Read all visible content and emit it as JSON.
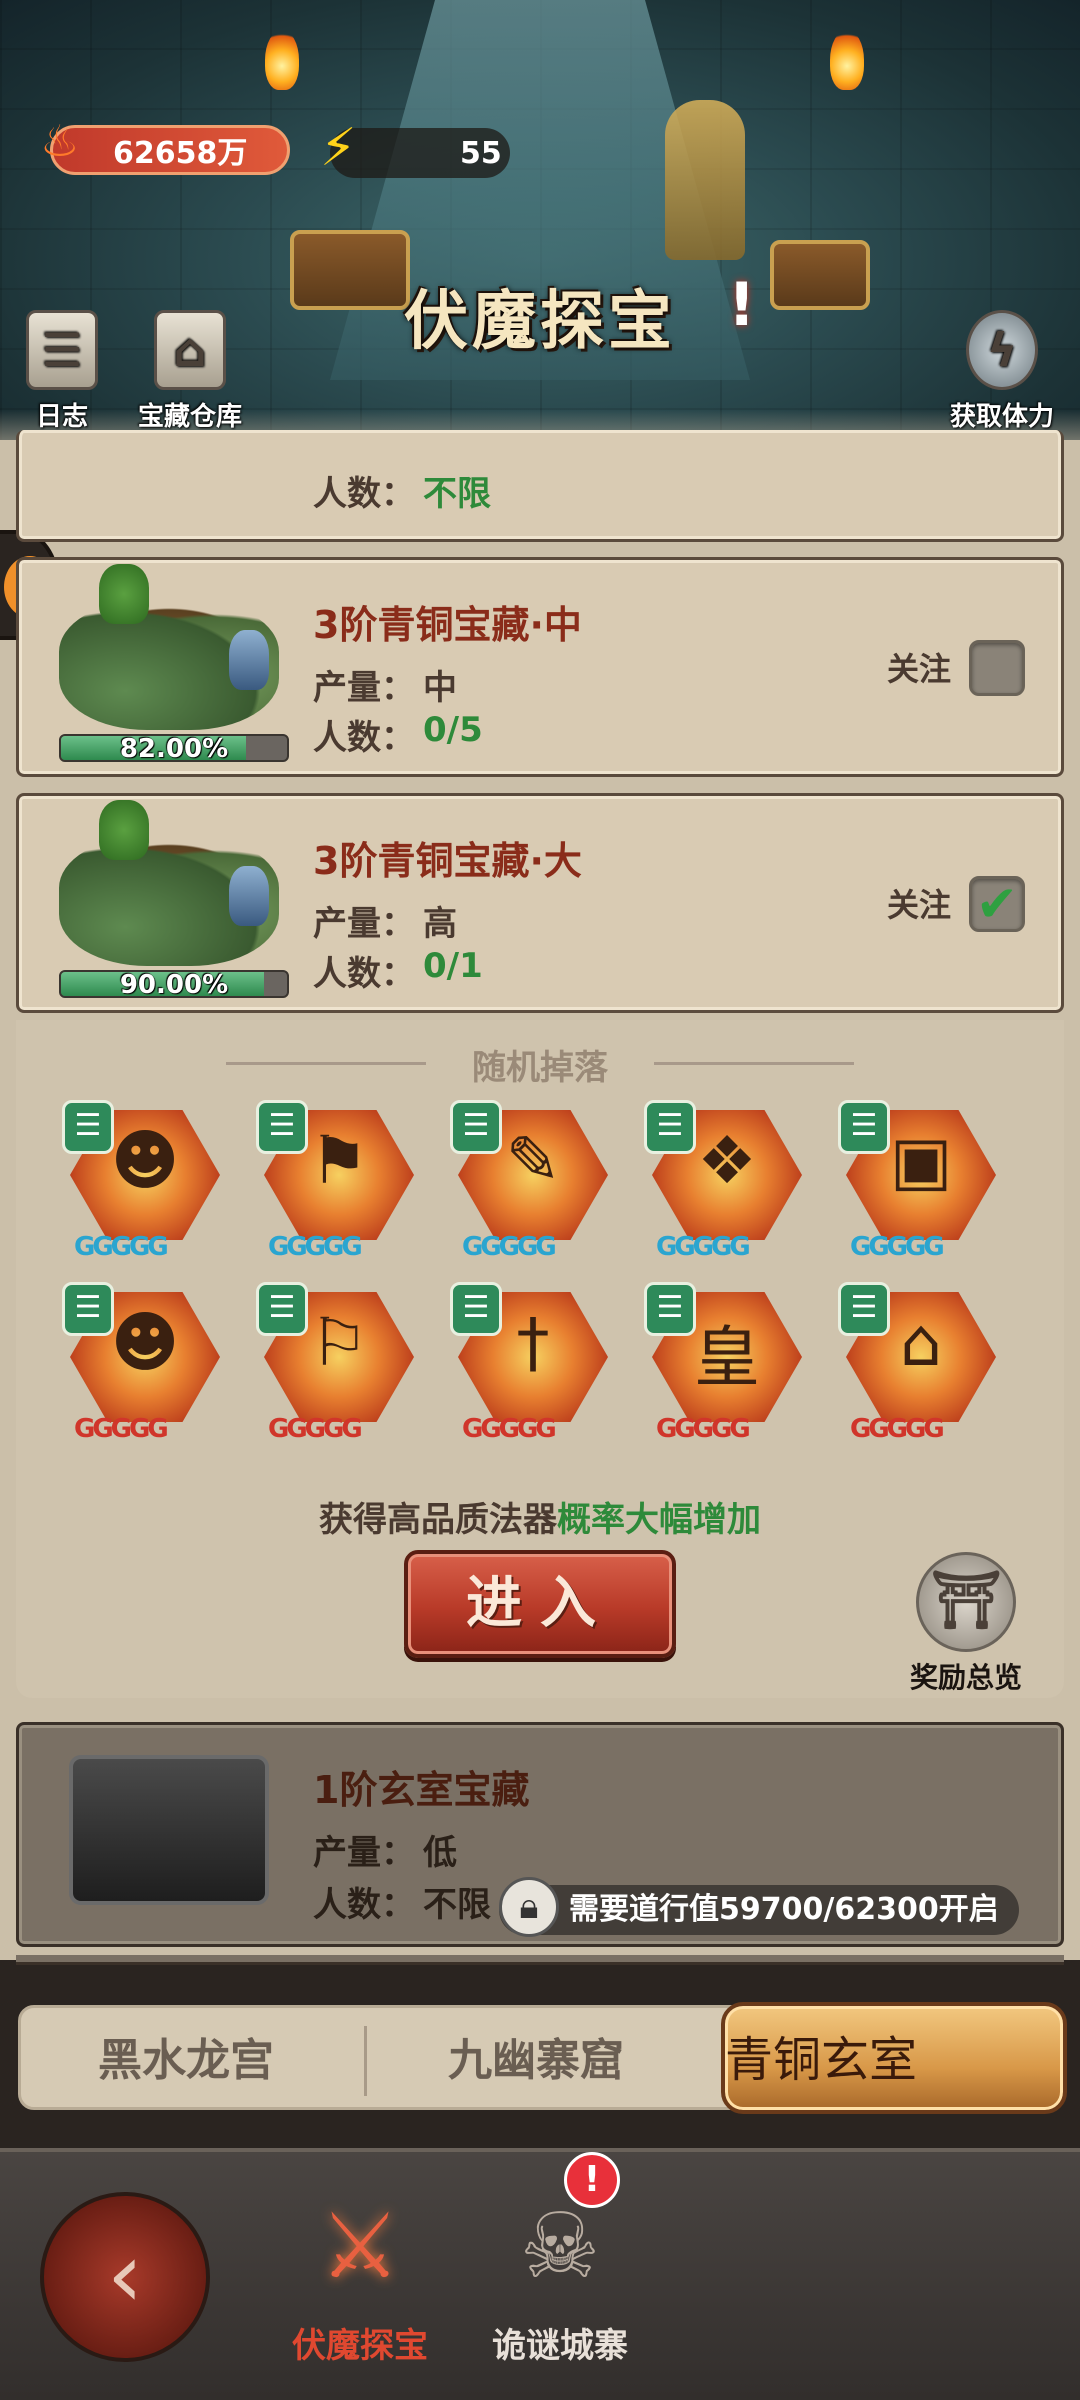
{
  "header": {
    "coins": "62658万",
    "energy": "55",
    "title": "伏魔探宝",
    "title_badge": "!",
    "btn_log": "日志",
    "btn_warehouse": "宝藏仓库",
    "btn_stamina": "获取体力"
  },
  "labels": {
    "output": "产量：",
    "people": "人数：",
    "follow": "关注"
  },
  "cards": [
    {
      "people": "不限"
    },
    {
      "title": "3阶青铜宝藏·中",
      "output": "中",
      "people": "0/5",
      "progress": "82.00%",
      "progress_value": 82.0,
      "followed": false
    },
    {
      "title": "3阶青铜宝藏·大",
      "output": "高",
      "people": "0/1",
      "progress": "90.00%",
      "progress_value": 90.0,
      "followed": true
    }
  ],
  "drops": {
    "title": "随机掉落",
    "items": [
      {
        "icon": "mask-icon",
        "glyph": "☻",
        "stars": "GGGGG",
        "tier": "blue"
      },
      {
        "icon": "banner-icon",
        "glyph": "⚑",
        "stars": "GGGGG",
        "tier": "blue"
      },
      {
        "icon": "brush-icon",
        "glyph": "✎",
        "stars": "GGGGG",
        "tier": "blue"
      },
      {
        "icon": "talisman-icon",
        "glyph": "❖",
        "stars": "GGGGG",
        "tier": "blue"
      },
      {
        "icon": "token-icon",
        "glyph": "▣",
        "stars": "GGGGG",
        "tier": "blue"
      },
      {
        "icon": "opera-mask-icon",
        "glyph": "☻",
        "stars": "GGGGG",
        "tier": "red"
      },
      {
        "icon": "flag-icon",
        "glyph": "⚐",
        "stars": "GGGGG",
        "tier": "red"
      },
      {
        "icon": "dagger-icon",
        "glyph": "†",
        "stars": "GGGGG",
        "tier": "red"
      },
      {
        "icon": "scroll-icon",
        "glyph": "皇",
        "stars": "GGGGG",
        "tier": "red"
      },
      {
        "icon": "pagoda-icon",
        "glyph": "⌂",
        "stars": "GGGGG",
        "tier": "red"
      }
    ],
    "bonus_prefix": "获得高品质法器",
    "bonus_highlight": "概率大幅增加",
    "enter": "进入",
    "reward_overview": "奖励总览"
  },
  "locked_card": {
    "title": "1阶玄室宝藏",
    "output": "低",
    "people": "不限",
    "requirement": "需要道行值59700/62300开启"
  },
  "tabs": [
    "黑水龙宫",
    "九幽寨窟",
    "青铜玄室"
  ],
  "active_tab": 2,
  "nav": {
    "item1": "伏魔探宝",
    "item2": "诡谜城寨",
    "badge": "!"
  },
  "colors": {
    "card_title": "#8a2c1a",
    "highlight_green": "#2e8a3a",
    "enter_button": "#b83a28",
    "active_nav": "#e04830"
  }
}
